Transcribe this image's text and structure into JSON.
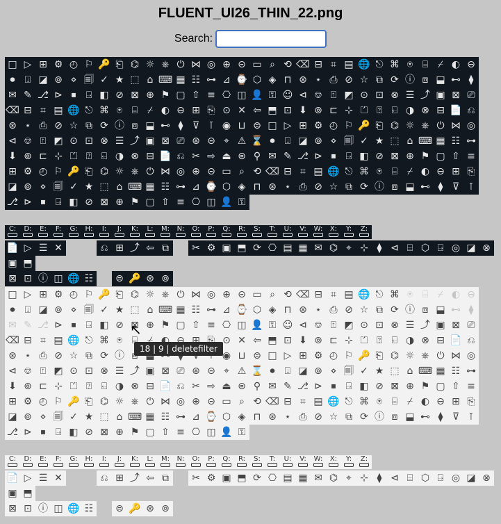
{
  "page": {
    "title": "FLUENT_UI26_THIN_22.png",
    "search_label": "Search:",
    "search_value": ""
  },
  "letters": [
    "C:",
    "D:",
    "E:",
    "F:",
    "G:",
    "H:",
    "I:",
    "J:",
    "K:",
    "L:",
    "M:",
    "N:",
    "O:",
    "P:",
    "Q:",
    "R:",
    "S:",
    "T:",
    "U:",
    "V:",
    "W:",
    "X:",
    "Y:",
    "Z:"
  ],
  "tooltip": {
    "row": "18",
    "col": "9",
    "name": "deletefilter",
    "text": "18 | 9 | deletefilter"
  },
  "glyphs": [
    "□",
    "▭",
    "⎘",
    "📄",
    "⊕",
    "⊗",
    "🗐",
    "⎙",
    "▷",
    "⌕",
    "⊙",
    "⎌",
    "⚑",
    "☰",
    "✓",
    "⊘",
    "⊞",
    "⟲",
    "✕",
    "✂",
    "▢",
    "⤴",
    "★",
    "☆",
    "⚙",
    "⌫",
    "⇦",
    "⇨",
    "⇧",
    "▣",
    "⬚",
    "⧉",
    "◴",
    "⊟",
    "⬒",
    "⏏",
    "≡",
    "⊠",
    "⌂",
    "⟳",
    "⚐",
    "⌗",
    "⊡",
    "⊜",
    "⎔",
    "⎚",
    "⌨",
    "ⓘ",
    "🔑",
    "▤",
    "⬇",
    "⚲",
    "◫",
    "⊛",
    "▦",
    "⧈",
    "⎗",
    "🌐",
    "⊚",
    "✉",
    "👤",
    "⊝",
    "☷",
    "⬓",
    "⌬",
    "⎋",
    "⊏",
    "✎",
    "⚿",
    "⌖",
    "⊶",
    "⊷",
    "☼",
    "⌘",
    "⊹",
    "⎇",
    "☺",
    "⚠",
    "⊿",
    "⧫",
    "⎈",
    "⍟",
    "⏍",
    "⊳",
    "⊲",
    "⌛",
    "⌚",
    "⊽",
    "⏻",
    "⌸",
    "⍰",
    "⏹",
    "⎊",
    "⏺",
    "⬡",
    "⊺",
    "⋈",
    "⌿",
    "⍇",
    "⍈",
    "⍐",
    "⍗",
    "◈",
    "◉",
    "◎",
    "◐",
    "◑",
    "◧",
    "◩",
    "◪",
    "⊓",
    "⊔",
    "⊕",
    "⊖",
    "⊗",
    "⊘",
    "⊙",
    "⊚",
    "⊛",
    "⊜",
    "⊝",
    "⊞",
    "⊟",
    "⊠",
    "⊡",
    "⋄",
    "⋆"
  ]
}
